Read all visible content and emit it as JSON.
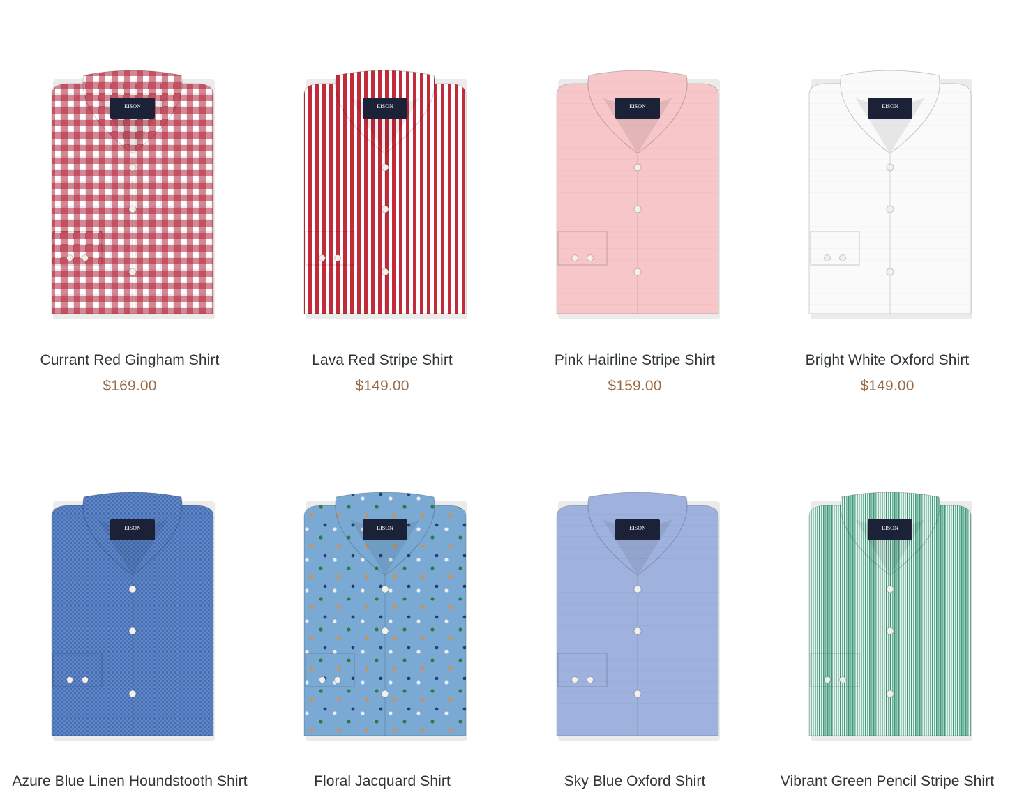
{
  "products": [
    {
      "name": "Currant Red Gingham Shirt",
      "price": "$169.00",
      "image_label": "shirt-image",
      "pattern": "gingham",
      "base": "#ffffff",
      "accent": "#b3243a",
      "brand": "EISON"
    },
    {
      "name": "Lava Red Stripe Shirt",
      "price": "$149.00",
      "image_label": "shirt-image",
      "pattern": "stripe",
      "base": "#ffffff",
      "accent": "#c32a3a",
      "brand": "EISON"
    },
    {
      "name": "Pink Hairline Stripe Shirt",
      "price": "$159.00",
      "image_label": "shirt-image",
      "pattern": "solid",
      "base": "#f6c6c8",
      "accent": "#efb6b9",
      "brand": "EISON"
    },
    {
      "name": "Bright White Oxford Shirt",
      "price": "$149.00",
      "image_label": "shirt-image",
      "pattern": "solid",
      "base": "#fafafa",
      "accent": "#eeeeee",
      "brand": "EISON"
    },
    {
      "name": "Azure Blue Linen Houndstooth Shirt",
      "price": "",
      "image_label": "shirt-image",
      "pattern": "linen",
      "base": "#5f86c6",
      "accent": "#3f67ad",
      "brand": "EISON"
    },
    {
      "name": "Floral Jacquard Shirt",
      "price": "",
      "image_label": "shirt-image",
      "pattern": "floral",
      "base": "#7aaad4",
      "accent": "#5d93c4",
      "brand": "EISON"
    },
    {
      "name": "Sky Blue Oxford Shirt",
      "price": "",
      "image_label": "shirt-image",
      "pattern": "solid",
      "base": "#9fb2de",
      "accent": "#8ea2d2",
      "brand": "EISON"
    },
    {
      "name": "Vibrant Green Pencil Stripe Shirt",
      "price": "",
      "image_label": "shirt-image",
      "pattern": "stripe-thin",
      "base": "#e6f2ec",
      "accent": "#3f9a7c",
      "brand": "EISON"
    }
  ]
}
